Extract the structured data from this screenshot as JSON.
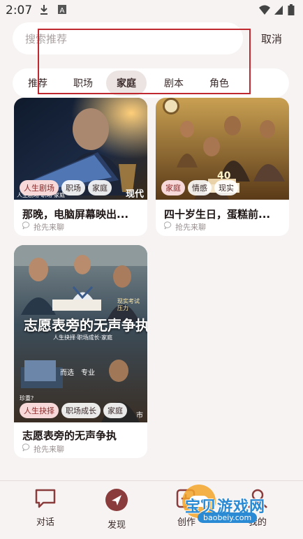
{
  "status": {
    "time": "2:07"
  },
  "search": {
    "placeholder": "搜索推荐",
    "cancel_label": "取消"
  },
  "tabs": [
    {
      "label": "推荐",
      "active": false
    },
    {
      "label": "职场",
      "active": false
    },
    {
      "label": "家庭",
      "active": true
    },
    {
      "label": "剧本",
      "active": false
    },
    {
      "label": "角色",
      "active": false
    }
  ],
  "cards": [
    {
      "title": "那晚，电脑屏幕映出...",
      "sub": "抢先来聊",
      "tags": [
        "人生剧场",
        "职场",
        "家庭"
      ],
      "badge": "现代",
      "caption": "人生剧场·职场·家庭"
    },
    {
      "title": "四十岁生日，蛋糕前...",
      "sub": "抢先来聊",
      "tags": [
        "家庭",
        "情感",
        "现实"
      ],
      "badge": "40"
    },
    {
      "title": "志愿表旁的无声争执",
      "sub": "抢先来聊",
      "tags": [
        "人生抉择",
        "职场成长",
        "家庭"
      ],
      "poster": {
        "headline": "志愿表旁的无声争执",
        "subline": "人生抉择·职场成长·家庭",
        "side": "现实考试压力",
        "mid": "而选　专业",
        "corner": "珍重?",
        "corner2": "市"
      }
    }
  ],
  "nav": [
    {
      "label": "对话",
      "icon": "chat-bubble-icon"
    },
    {
      "label": "发现",
      "icon": "compass-icon"
    },
    {
      "label": "创作",
      "icon": "create-icon"
    },
    {
      "label": "我的",
      "icon": "profile-icon"
    }
  ],
  "watermark": {
    "text": "宝贝游戏网",
    "url": "baobeiy.com"
  },
  "colors": {
    "accent": "#8a3b3b",
    "highlight_box": "#c0282f",
    "tag_highlight": "#f6d9d8"
  }
}
